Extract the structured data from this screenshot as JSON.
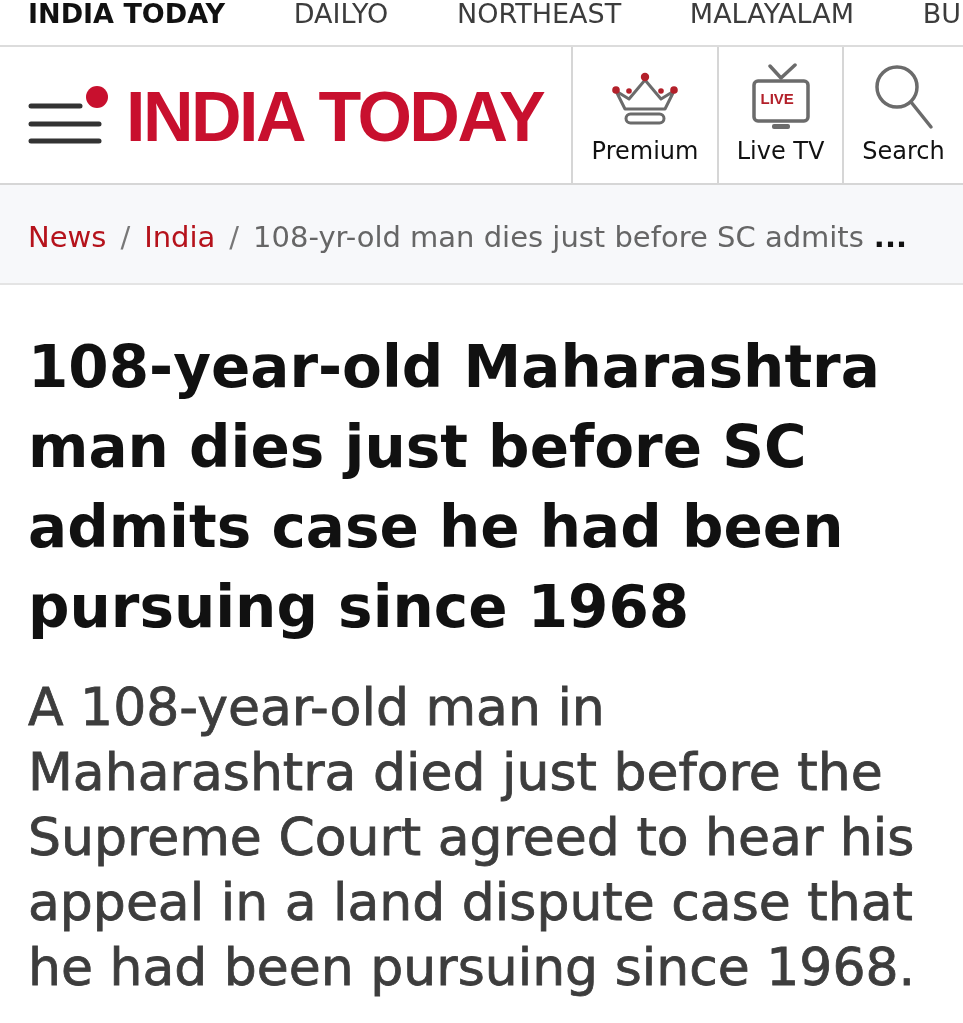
{
  "top_nav": {
    "items": [
      {
        "label": "INDIA TODAY",
        "selected": true
      },
      {
        "label": "DAILYO",
        "selected": false
      },
      {
        "label": "NORTHEAST",
        "selected": false
      },
      {
        "label": "MALAYALAM",
        "selected": false
      },
      {
        "label": "BU",
        "selected": false
      }
    ]
  },
  "header": {
    "logo": "INDIA TODAY",
    "actions": [
      {
        "kind": "premium",
        "label": "Premium"
      },
      {
        "kind": "live_tv",
        "label": "Live TV",
        "badge": "LIVE"
      },
      {
        "kind": "search",
        "label": "Search"
      }
    ]
  },
  "breadcrumb": {
    "items": [
      {
        "kind": "link",
        "label": "News"
      },
      {
        "kind": "separator",
        "label": "/"
      },
      {
        "kind": "link",
        "label": "India"
      },
      {
        "kind": "separator",
        "label": "/"
      },
      {
        "kind": "current",
        "label": "108-yr-old man dies just before SC admits"
      }
    ],
    "ellipsis": "..."
  },
  "article": {
    "headline": "108-year-old Maharashtra man dies just before SC admits case he had been pursuing since 1968",
    "summary": "A 108-year-old man in Maharashtra died just before the Supreme Court agreed to hear his appeal in a land dispute case that he had been pursuing since 1968."
  }
}
